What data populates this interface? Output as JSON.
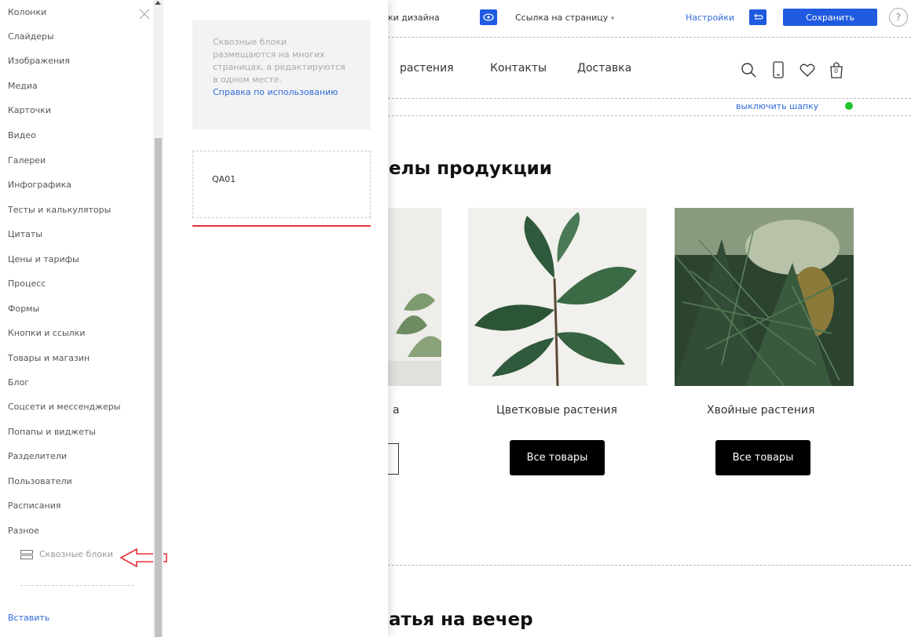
{
  "sidebar": {
    "items": [
      "Колонки",
      "Слайдеры",
      "Изображения",
      "Медиа",
      "Карточки",
      "Видео",
      "Галереи",
      "Инфографика",
      "Тесты и калькуляторы",
      "Цитаты",
      "Цены и тарифы",
      "Процесс",
      "Формы",
      "Кнопки и ссылки",
      "Товары и магазин",
      "Блог",
      "Соцсети и мессенджеры",
      "Попапы и виджеты",
      "Разделители",
      "Пользователи",
      "Расписания",
      "Разное"
    ],
    "through_blocks_label": "Сквозные блоки",
    "paste_label": "Вставить"
  },
  "panel": {
    "info_text": "Сквозные блоки размещаются на многих страницах, а редактируются в одном месте.",
    "info_link": "Справка по использованию",
    "block_name": "QA01"
  },
  "toolbar": {
    "design_label": "ки дизайна",
    "page_link_label": "Ссылка на страницу",
    "page_link_caret": "▾",
    "settings_label": "Настройки",
    "save_label": "Сохранить",
    "help_label": "?"
  },
  "site_nav": {
    "items": [
      "растения",
      "Контакты",
      "Доставка"
    ],
    "cart_count": "0"
  },
  "header_toggle": {
    "label": "выключить шапку",
    "status_color": "#22c42b"
  },
  "products": {
    "title": "елы продукции",
    "items": [
      {
        "name": "Цветковые растения",
        "button": "Все товары"
      },
      {
        "name": "Хвойные растения",
        "button": "Все товары"
      }
    ],
    "partial_caption": "а"
  },
  "section2": {
    "title": "атья на вечер"
  },
  "colors": {
    "accent": "#1f5ae0",
    "link": "#2f6ad9",
    "highlight": "#e5323b"
  }
}
